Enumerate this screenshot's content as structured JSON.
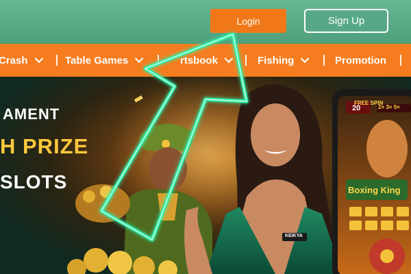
{
  "header": {
    "login_label": "Login",
    "signup_label": "Sign Up"
  },
  "nav": {
    "items": [
      {
        "label": "Crash",
        "has_dropdown": true
      },
      {
        "label": "Table Games",
        "has_dropdown": true
      },
      {
        "label": "rtsbook",
        "has_dropdown": true
      },
      {
        "label": "Fishing",
        "has_dropdown": true
      },
      {
        "label": "Promotion",
        "has_dropdown": false
      }
    ]
  },
  "banner": {
    "line1": "AMENT",
    "line2": "H PRIZE",
    "line3": "SLOTS",
    "phone_game_title": "Boxing King",
    "phone_free_spin": "FREE SPIN",
    "phone_spin_count": "20",
    "phone_multipliers": "2× 3× 5×",
    "shirt_logo": "KEIKYA"
  },
  "colors": {
    "topbar": "#5aa986",
    "navbar": "#f57d1f",
    "login_button": "#f07818",
    "arrow_glow": "#2ff0a8"
  },
  "icons": {
    "dropdown": "chevron-down-icon",
    "pointer": "arrow-up-icon"
  }
}
